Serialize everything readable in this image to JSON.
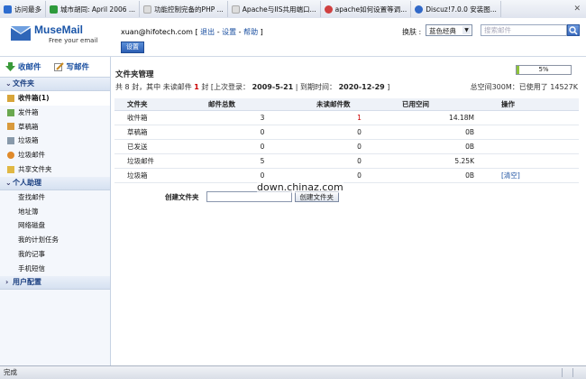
{
  "tabs": [
    {
      "label": "访问最多",
      "color": "#2d6ccf"
    },
    {
      "label": "城市胡同: April 2006 ...",
      "color": "#2e9a3c"
    },
    {
      "label": "功能控制完备的PHP ...",
      "color": "#dddddd"
    },
    {
      "label": "Apache与IIS共用端口...",
      "color": "#dddddd"
    },
    {
      "label": "apache如何设置等调...",
      "color": "#d04040"
    },
    {
      "label": "Discuz!7.0.0 安装图...",
      "color": "#3068c8"
    }
  ],
  "header": {
    "logo_title": "MuseMail",
    "logo_sub": "Free your email",
    "user_email": "xuan@hifotech.com",
    "logout": "退出",
    "settings": "设置",
    "help": "帮助",
    "settings_button": "设置",
    "skin_label": "换肤 :",
    "skin_value": "蓝色经典",
    "search_placeholder": "搜索邮件"
  },
  "sidebar": {
    "receive": "收邮件",
    "compose": "写邮件",
    "folders_title": "文件夹",
    "folders": [
      {
        "label": "收件箱(1)",
        "icon": "inbox-icon",
        "color": "#d8a53a",
        "bold": true
      },
      {
        "label": "发件箱",
        "icon": "outbox-icon",
        "color": "#6aa84f"
      },
      {
        "label": "草稿箱",
        "icon": "drafts-icon",
        "color": "#d99a3c"
      },
      {
        "label": "垃圾箱",
        "icon": "trash-icon",
        "color": "#8899aa"
      },
      {
        "label": "垃圾邮件",
        "icon": "spam-icon",
        "color": "#e08a2a"
      },
      {
        "label": "共享文件夹",
        "icon": "shared-folder-icon",
        "color": "#e0b844"
      }
    ],
    "assistant_title": "个人助理",
    "assistant": [
      "查找邮件",
      "地址簿",
      "网络磁盘",
      "我的计划任务",
      "我的记事",
      "手机短信"
    ],
    "config_title": "用户配置"
  },
  "main": {
    "title": "文件夹管理",
    "progress_text": "5%",
    "progress": 0.05,
    "stats": {
      "prefix": "共 8 封，其中 未读邮件",
      "unread": "1",
      "mid": "封 [上次登录：",
      "last_login": "2009-5-21",
      "mid2": "| 到期时间：",
      "expire": "2020-12-29",
      "suffix": "]"
    },
    "quota": "总空间300M：已使用了 14527K",
    "columns": [
      "文件夹",
      "邮件总数",
      "未读邮件数",
      "已用空间",
      "操作"
    ],
    "rows": [
      {
        "folder": "收件箱",
        "total": "3",
        "unread": "1",
        "size": "14.18M",
        "action": ""
      },
      {
        "folder": "草稿箱",
        "total": "0",
        "unread": "0",
        "size": "0B",
        "action": ""
      },
      {
        "folder": "已发送",
        "total": "0",
        "unread": "0",
        "size": "0B",
        "action": ""
      },
      {
        "folder": "垃圾邮件",
        "total": "5",
        "unread": "0",
        "size": "5.25K",
        "action": ""
      },
      {
        "folder": "垃圾箱",
        "total": "0",
        "unread": "0",
        "size": "0B",
        "action": "[清空]"
      }
    ],
    "create_label": "创建文件夹",
    "create_button": "创建文件夹"
  },
  "watermark": "down.chinaz.com",
  "status": "完成"
}
